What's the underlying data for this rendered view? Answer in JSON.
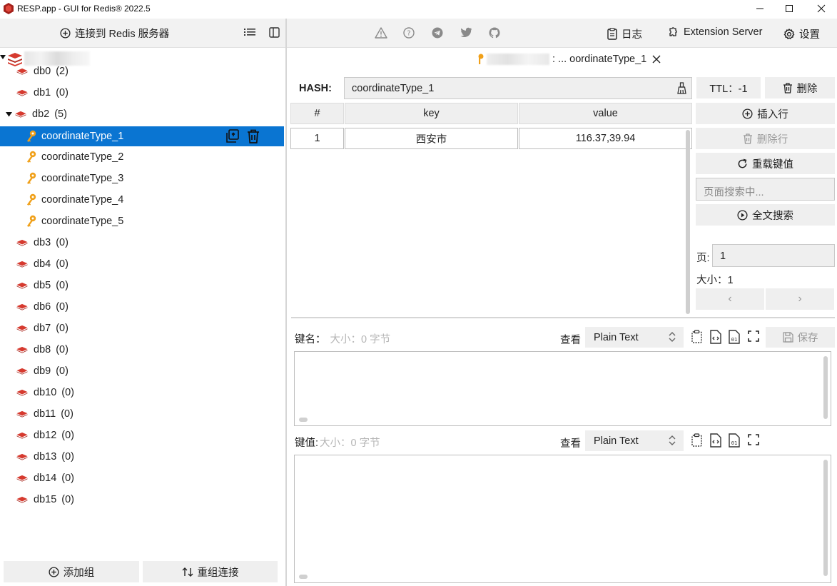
{
  "window": {
    "title": "RESP.app - GUI for Redis® 2022.5",
    "minimize": "—",
    "maximize": "☐",
    "close": "✕"
  },
  "left_toolbar": {
    "connect_label": "连接到 Redis 服务器"
  },
  "right_toolbar": {
    "log_label": "日志",
    "extension_label": "Extension Server",
    "settings_label": "设置"
  },
  "tree": {
    "databases_before": [
      {
        "name": "db0",
        "count": "(2)"
      },
      {
        "name": "db1",
        "count": "(0)"
      }
    ],
    "expanded_db": {
      "name": "db2",
      "count": "(5)"
    },
    "keys": [
      "coordinateType_1",
      "coordinateType_2",
      "coordinateType_3",
      "coordinateType_4",
      "coordinateType_5"
    ],
    "databases_after": [
      {
        "name": "db3",
        "count": "(0)"
      },
      {
        "name": "db4",
        "count": "(0)"
      },
      {
        "name": "db5",
        "count": "(0)"
      },
      {
        "name": "db6",
        "count": "(0)"
      },
      {
        "name": "db7",
        "count": "(0)"
      },
      {
        "name": "db8",
        "count": "(0)"
      },
      {
        "name": "db9",
        "count": "(0)"
      },
      {
        "name": "db10",
        "count": "(0)"
      },
      {
        "name": "db11",
        "count": "(0)"
      },
      {
        "name": "db12",
        "count": "(0)"
      },
      {
        "name": "db13",
        "count": "(0)"
      },
      {
        "name": "db14",
        "count": "(0)"
      },
      {
        "name": "db15",
        "count": "(0)"
      }
    ]
  },
  "left_bottom": {
    "add_group": "添加组",
    "regroup": "重组连接"
  },
  "tab": {
    "label": ": ... oordinateType_1",
    "close": "✕"
  },
  "key_header": {
    "type_label": "HASH:",
    "key_name": "coordinateType_1",
    "ttl": "TTL：-1",
    "delete": "删除"
  },
  "table": {
    "columns": [
      "#",
      "key",
      "value"
    ],
    "rows": [
      {
        "index": "1",
        "key": "西安市",
        "value": "116.37,39.94"
      }
    ]
  },
  "side_actions": {
    "insert_row": "插入行",
    "delete_row": "删除行",
    "reload": "重载键值",
    "page_search_placeholder": "页面搜索中...",
    "full_search": "全文搜索",
    "page_label": "页:",
    "page_value": "1",
    "size_label": "大小：1",
    "prev": "‹",
    "next": "›"
  },
  "key_editor": {
    "label": "键名：",
    "meta": "大小：0 字节",
    "view_label": "查看",
    "view_mode": "Plain Text",
    "save": "保存"
  },
  "value_editor": {
    "label": "键值:",
    "meta": "大小：0 字节",
    "view_label": "查看",
    "view_mode": "Plain Text"
  },
  "colors": {
    "selection": "#0a75d2",
    "redis_red": "#d63a2f",
    "key_orange": "#f0a019",
    "panel_bg": "#f2f2f2"
  }
}
